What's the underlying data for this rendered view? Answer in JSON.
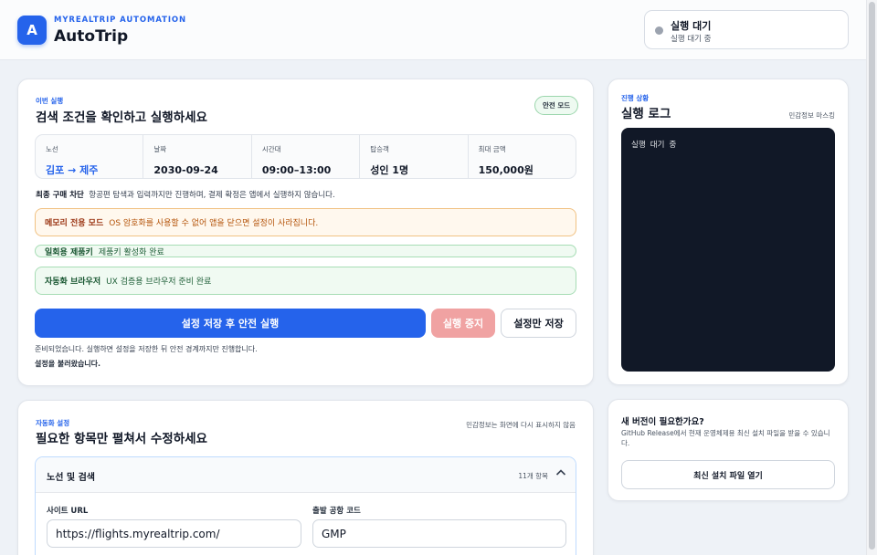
{
  "header": {
    "logo_letter": "A",
    "brand_sub": "MYREALTRIP AUTOMATION",
    "brand_title": "AutoTrip",
    "status_title": "실행 대기",
    "status_sub": "실행 대기 중"
  },
  "run_card": {
    "eyebrow": "이번 실행",
    "title": "검색 조건을 확인하고 실행하세요",
    "safe_mode": "안전 모드",
    "summary": [
      {
        "label": "노선",
        "value": "김포 → 제주"
      },
      {
        "label": "날짜",
        "value": "2030-09-24"
      },
      {
        "label": "시간대",
        "value": "09:00–13:00"
      },
      {
        "label": "탑승객",
        "value": "성인 1명"
      },
      {
        "label": "최대 금액",
        "value": "150,000원"
      }
    ],
    "final_label": "최종 구매 차단",
    "final_text": "항공편 탐색과 입력까지만 진행하며, 결제 확정은 앱에서 실행하지 않습니다.",
    "memory_label": "메모리 전용 모드",
    "memory_text": "OS 암호화를 사용할 수 없어 앱을 닫으면 설정이 사라집니다.",
    "key_label": "일회용 제품키",
    "key_text": "제품키 활성화 완료",
    "browser_label": "자동화 브라우저",
    "browser_text": "UX 검증용 브라우저 준비 완료",
    "btn_run": "설정 저장 후 안전 실행",
    "btn_stop": "실행 중지",
    "btn_save": "설정만 저장",
    "hint1": "준비되었습니다. 실행하면 설정을 저장한 뒤 안전 경계까지만 진행합니다.",
    "hint2": "설정을 불러왔습니다."
  },
  "log_card": {
    "eyebrow": "진행 상황",
    "title": "실행 로그",
    "mask": "민감정보 마스킹",
    "log_text": "실행 대기 중"
  },
  "settings_card": {
    "eyebrow": "자동화 설정",
    "title": "필요한 항목만 펼쳐서 수정하세요",
    "note": "민감정보는 화면에 다시 표시하지 않음",
    "section_title": "노선 및 검색",
    "section_count": "11개 항목",
    "chevron": "chevron-up-icon",
    "site_url_label": "사이트 URL",
    "site_url_value": "https://flights.myrealtrip.com/",
    "airport_label": "출발 공항 코드",
    "airport_value": "GMP"
  },
  "update_card": {
    "title": "새 버전이 필요한가요?",
    "desc": "GitHub Release에서 현재 운영체제용 최신 설치 파일을 받을 수 있습니다.",
    "button": "최신 설치 파일 열기"
  },
  "colors": {
    "accent": "#2563eb",
    "warn": "#f1c283",
    "ok": "#a7ddb5",
    "stop": "#f0a2a2",
    "log_bg": "#111827"
  }
}
